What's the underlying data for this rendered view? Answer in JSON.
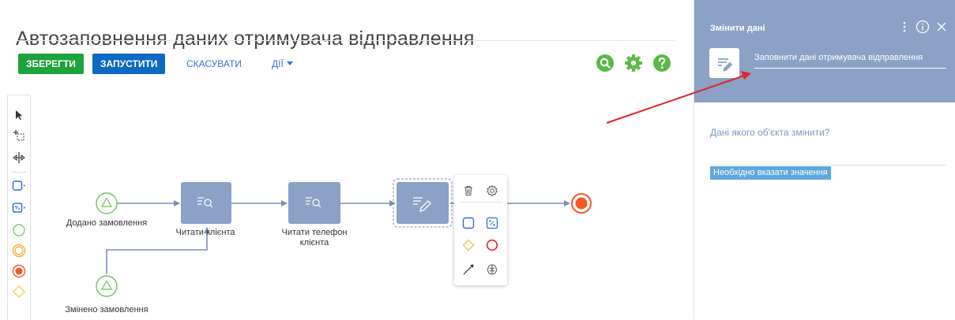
{
  "page": {
    "title": "Автозаповнення даних отримувача відправлення"
  },
  "toolbar": {
    "save_label": "ЗБЕРЕГТИ",
    "run_label": "ЗАПУСТИТИ",
    "cancel_label": "СКАСУВАТИ",
    "actions_label": "ДІЇ"
  },
  "colors": {
    "accent_green": "#1ea23a",
    "accent_blue": "#0d6ac3",
    "link_blue": "#3176c9",
    "task_fill": "#8ba1c6",
    "panel_header": "#8ba1c6",
    "start_event": "#6ac259",
    "end_event": "#f05a28",
    "annotation_arrow": "#e0242c",
    "error_badge": "#5ea8de"
  },
  "process": {
    "nodes": {
      "start_order_added": "Додано замовлення",
      "start_order_changed": "Змінено замовлення",
      "read_client": "Читати клієнта",
      "read_client_phone": "Читати телефон клієнта"
    }
  },
  "panel": {
    "title": "Змінити дані",
    "element_name": "Заповнити дані отримувача відправлення",
    "question": "Дані якого об'єкта змінити?",
    "error": "Необхідно вказати значення"
  }
}
